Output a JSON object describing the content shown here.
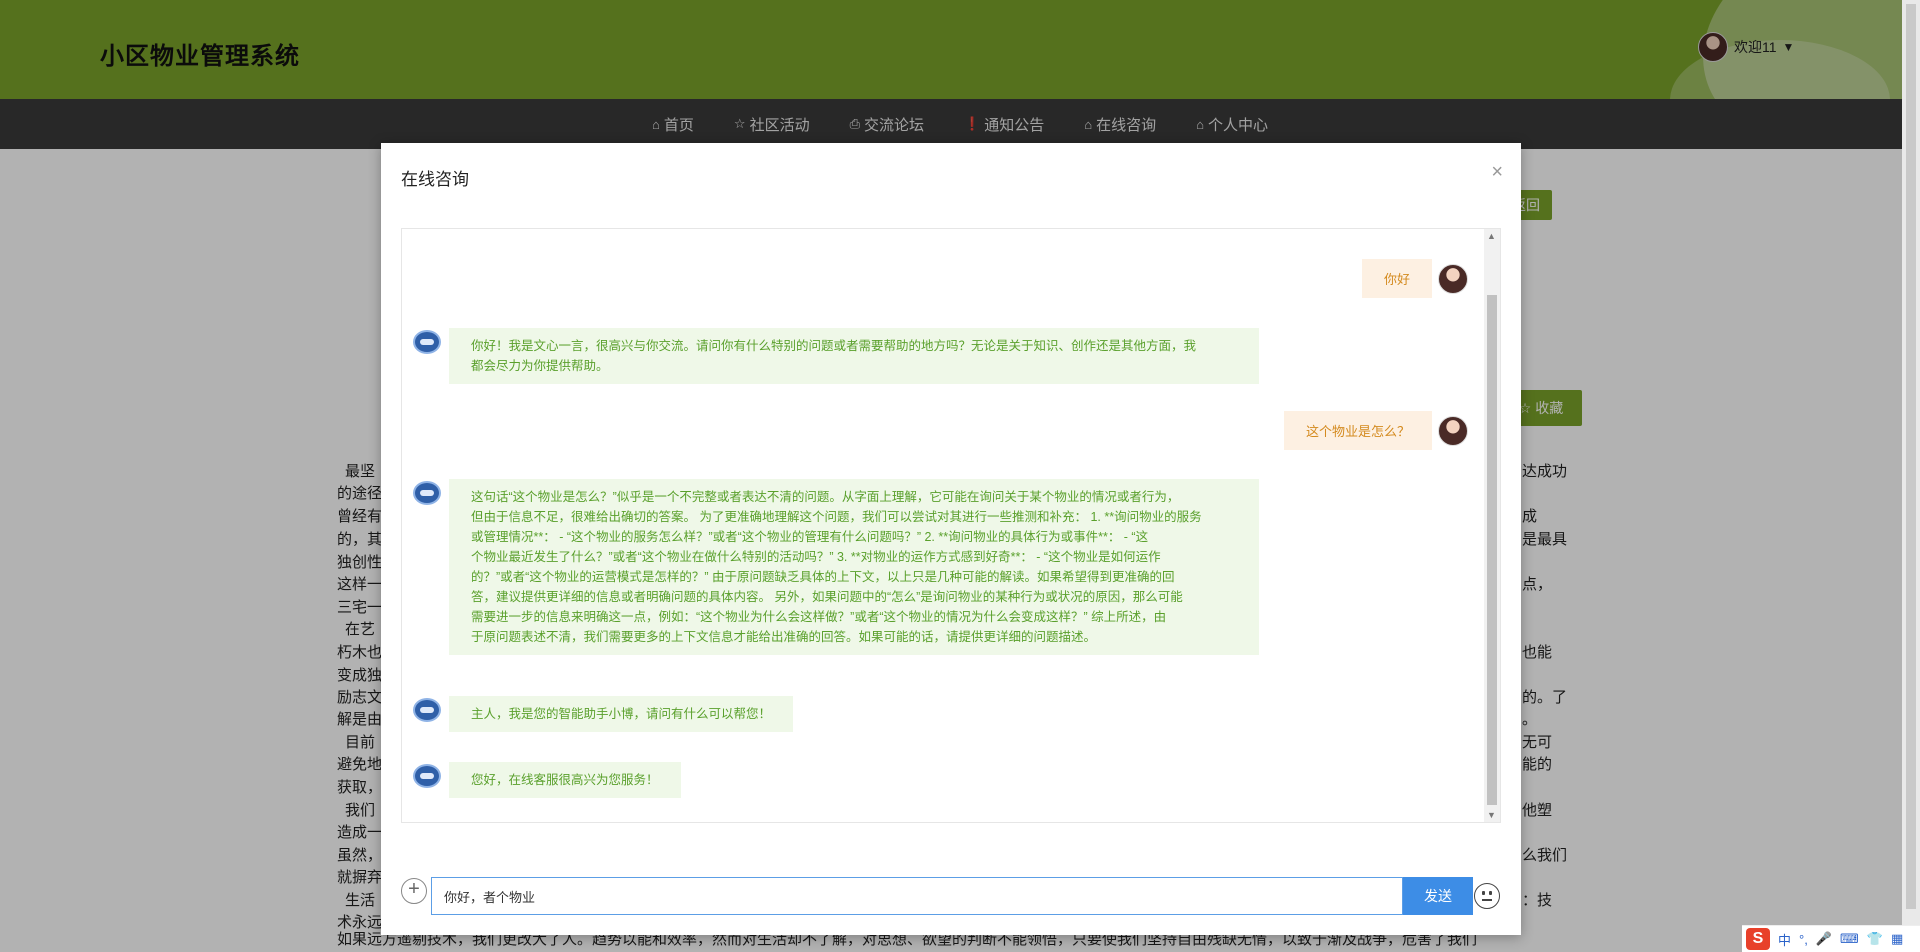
{
  "header": {
    "site_title": "小区物业管理系统",
    "user_greeting": "欢迎11",
    "caret": "▼"
  },
  "nav": [
    {
      "icon": "⌂",
      "icon_name": "home-icon",
      "label": "首页"
    },
    {
      "icon": "☆",
      "icon_name": "star-icon",
      "label": "社区活动"
    },
    {
      "icon": "⎙",
      "icon_name": "bag-icon",
      "label": "交流论坛"
    },
    {
      "icon": "❗",
      "icon_name": "alert-icon",
      "label": "通知公告"
    },
    {
      "icon": "⌂",
      "icon_name": "home-icon",
      "label": "在线咨询"
    },
    {
      "icon": "⌂",
      "icon_name": "home-icon",
      "label": "个人中心"
    }
  ],
  "background_page": {
    "return_button": "返回",
    "favorite_button": "☆ 收藏",
    "left_fragments": [
      "最坚",
      "的途径",
      "曾经有",
      "的，其",
      "独创性",
      "这样一",
      "三宅一",
      "在艺",
      "朽木也",
      "变成独",
      "励志文",
      "解是由",
      "目前",
      "避免地",
      "获取，",
      "我们",
      "造成一",
      "虽然，",
      "就摒弃",
      "生活",
      "术永远",
      "如果远方遥剔技术，我们更改大了人。趋势以能和效率，然而对生活却不了解，对思想、欲望的判断不能领悟，只要使我们坚持自由残缺无情，以致于渐及战争，危害了我们"
    ],
    "right_fragments": [
      "达成功",
      "成",
      "是最具",
      "点，",
      "",
      "也能",
      "的。了",
      "。",
      "无可",
      "能的",
      "",
      "他塑",
      "么我们",
      "",
      "：技"
    ]
  },
  "modal": {
    "title": "在线咨询",
    "close": "×",
    "messages": [
      {
        "role": "user",
        "text": "你好"
      },
      {
        "role": "bot",
        "lines": [
          "你好！我是文心一言，很高兴与你交流。请问你有什么特别的问题或者需要帮助的地方吗？无论是关于知识、创作还是其他方面，我",
          "都会尽力为你提供帮助。"
        ]
      },
      {
        "role": "user",
        "text": "这个物业是怎么？"
      },
      {
        "role": "bot",
        "lines": [
          "这句话“这个物业是怎么？”似乎是一个不完整或者表达不清的问题。从字面上理解，它可能在询问关于某个物业的情况或者行为，",
          "但由于信息不足，很难给出确切的答案。 为了更准确地理解这个问题，我们可以尝试对其进行一些推测和补充： 1. **询问物业的服务",
          "或管理情况**： - “这个物业的服务怎么样？”或者“这个物业的管理有什么问题吗？” 2. **询问物业的具体行为或事件**： - “这",
          "个物业最近发生了什么？”或者“这个物业在做什么特别的活动吗？” 3. **对物业的运作方式感到好奇**： - “这个物业是如何运作",
          "的？”或者“这个物业的运营模式是怎样的？” 由于原问题缺乏具体的上下文，以上只是几种可能的解读。如果希望得到更准确的回",
          "答，建议提供更详细的信息或者明确问题的具体内容。 另外，如果问题中的“怎么”是询问物业的某种行为或状况的原因，那么可能",
          "需要进一步的信息来明确这一点，例如：“这个物业为什么会这样做？”或者“这个物业的情况为什么会变成这样？” 综上所述，由",
          "于原问题表述不清，我们需要更多的上下文信息才能给出准确的回答。如果可能的话，请提供更详细的问题描述。"
        ]
      },
      {
        "role": "bot",
        "lines": [
          "主人，我是您的智能助手小博，请问有什么可以帮您！"
        ]
      },
      {
        "role": "bot",
        "lines": [
          "您好，在线客服很高兴为您服务！"
        ]
      }
    ],
    "input_value": "你好，者个物业",
    "send_label": "发送",
    "plus": "+"
  },
  "ime": {
    "logo": "S",
    "items": [
      "中",
      "°,",
      "🎤",
      "⌨",
      "👕",
      "▦"
    ]
  },
  "colors": {
    "header_green": "#7aa32a",
    "nav_dark": "#3a3a3a",
    "send_blue": "#3d8de6",
    "bot_text": "#5aa02c",
    "user_text": "#d48a1e"
  }
}
